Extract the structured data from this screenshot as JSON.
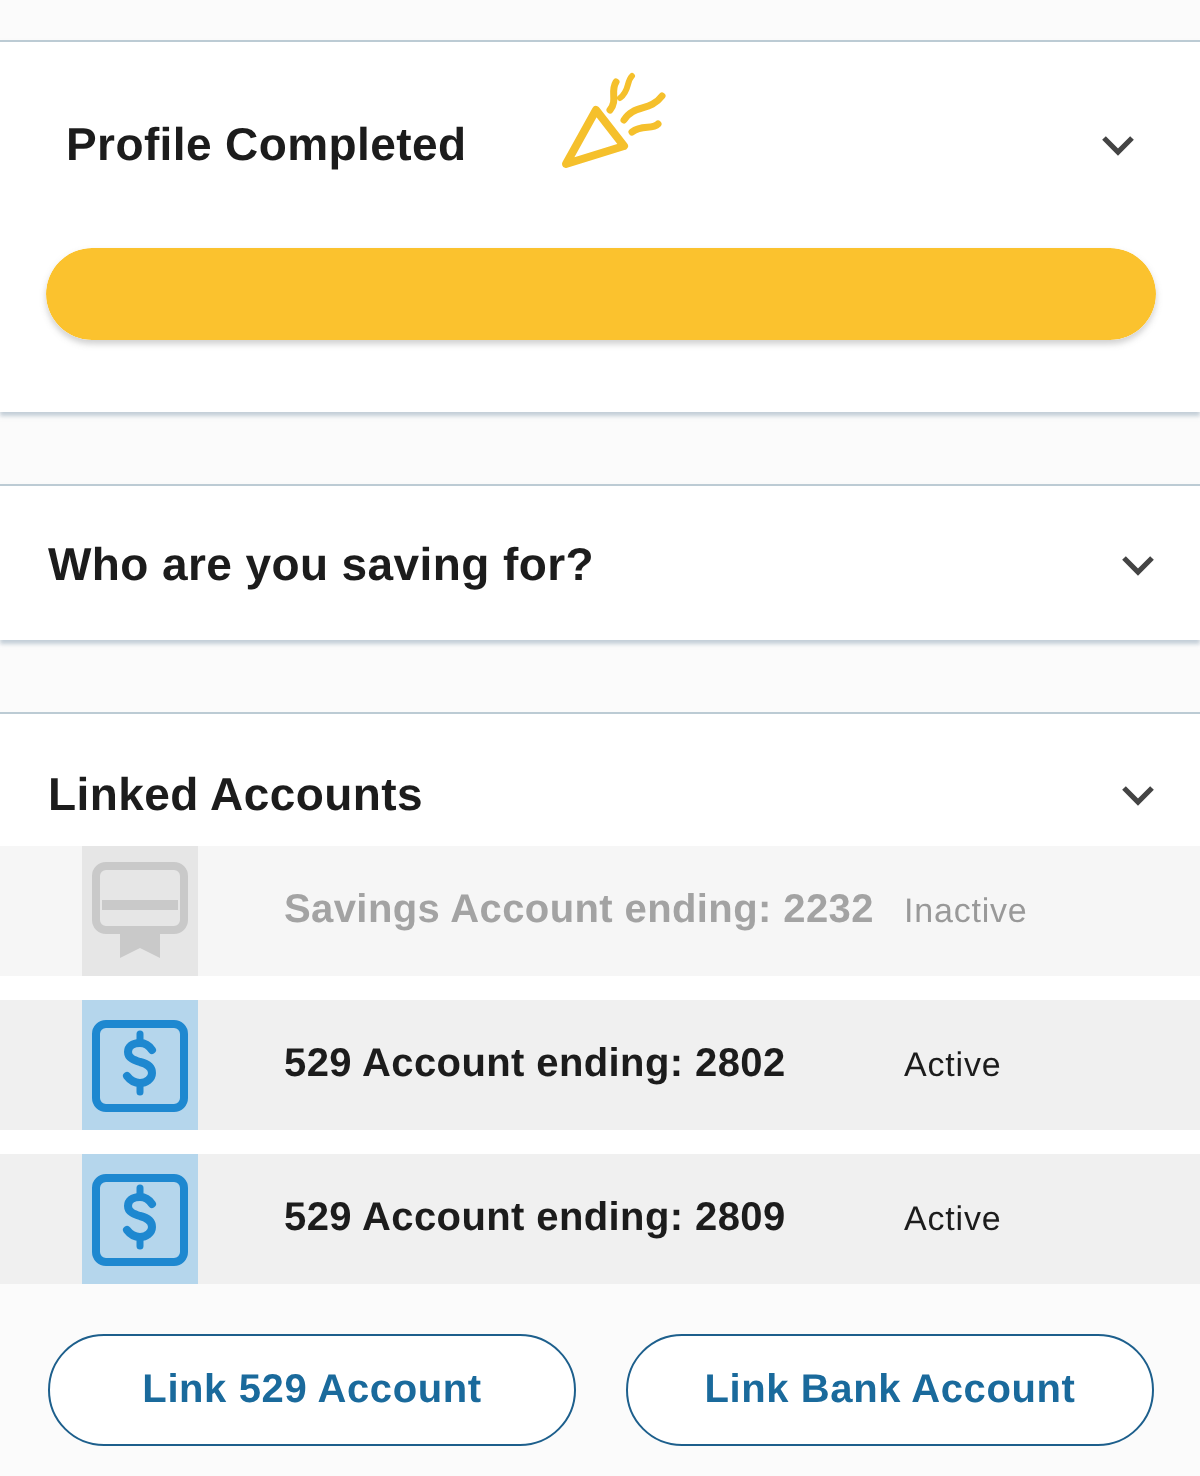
{
  "profile": {
    "title": "Profile Completed",
    "progress": {
      "level": 1
    }
  },
  "saving_for": {
    "title": "Who are you saving for?"
  },
  "linked_accounts": {
    "title": "Linked Accounts",
    "accounts": [
      {
        "kind": "savings",
        "name": "Savings Account ending: 2232",
        "status": "Inactive",
        "active": false
      },
      {
        "kind": "plan",
        "name": "529 Account ending: 2802",
        "status": "Active",
        "active": true
      },
      {
        "kind": "plan",
        "name": "529 Account ending: 2809",
        "status": "Active",
        "active": true
      }
    ]
  },
  "buttons": [
    "Link 529 Account",
    "Link Bank Account"
  ]
}
